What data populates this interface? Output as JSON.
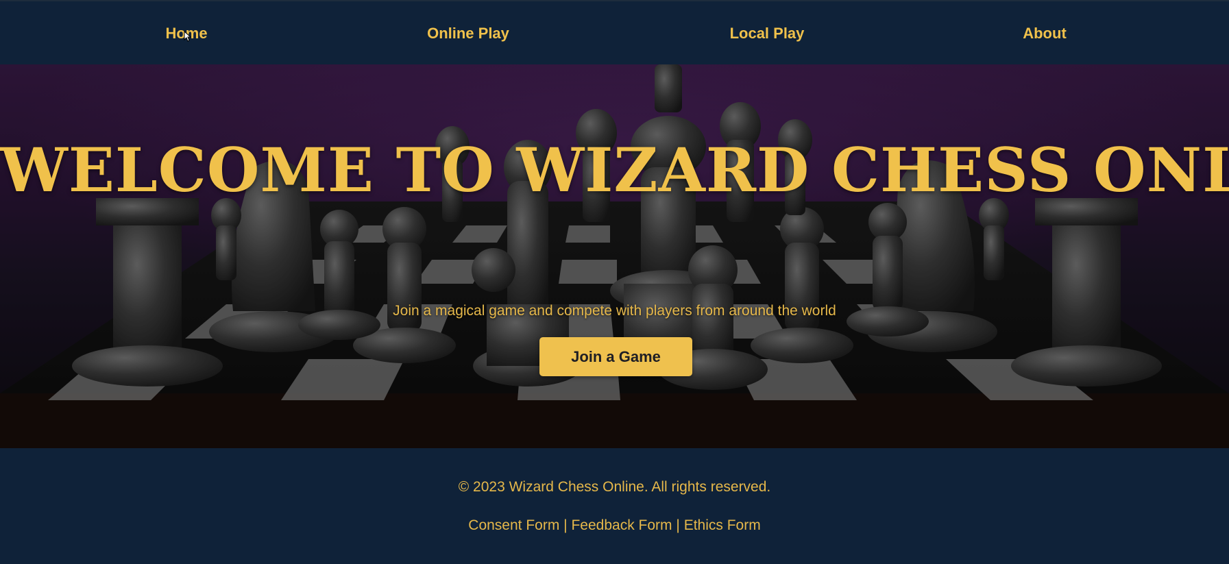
{
  "nav": {
    "items": [
      {
        "label": "Home"
      },
      {
        "label": "Online Play"
      },
      {
        "label": "Local Play"
      },
      {
        "label": "About"
      }
    ]
  },
  "hero": {
    "title": "WELCOME TO WIZARD CHESS ONLINE",
    "subtitle": "Join a magical game and compete with players from around the world",
    "button_label": "Join a Game"
  },
  "footer": {
    "copyright": "© 2023 Wizard Chess Online. All rights reserved.",
    "links": [
      {
        "label": "Consent Form"
      },
      {
        "label": "Feedback Form"
      },
      {
        "label": "Ethics Form"
      }
    ],
    "separator": "|"
  },
  "colors": {
    "accent": "#f0c14b",
    "navy": "#0f2239",
    "hero_purple": "#3a1b48"
  }
}
